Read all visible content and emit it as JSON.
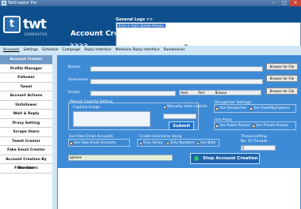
{
  "titlebar": {
    "title": "TwtCreator Pro"
  },
  "logo": {
    "word": "twt",
    "letter": "t",
    "sub": "DOMINATOR"
  },
  "page": {
    "title": "Account Creation",
    "arrows": ">>>>"
  },
  "logs": {
    "label": "General Logs >>",
    "line": "Error in Auto Update Module"
  },
  "menu": [
    "Accounts",
    "Settings",
    "Schedule",
    "Campaign",
    "Reply Interface",
    "Mentions Reply Interface",
    "Randomiser"
  ],
  "sidebar": [
    "Account Creator",
    "Profile Manager",
    "Follower",
    "Tweet",
    "Account Actions",
    "Unfollower",
    "Wait & Reply",
    "Proxy Setting",
    "Scrape Users",
    "Tweet Creator",
    "Fake Email Creator",
    "Account Creation By Browser",
    "Filter Users"
  ],
  "form": {
    "names_label": "Names",
    "usernames_label": "Usernames",
    "emails_label": "Emails",
    "browse": "Browse for File",
    "email_row_values": [
      "Host",
      "Port",
      "Browse"
    ],
    "captcha": {
      "title": "Manual Captcha Setting",
      "image_label": "Captcha Image",
      "manual": "Manually enter captcha",
      "submit": "Submit"
    },
    "decaptcher": {
      "title": "Decaptcher Settings",
      "use_decaptcher": "Use Decaptcher",
      "use_dbc": "Use DeathByCaptcha"
    },
    "proxy": {
      "title": "Use Proxy",
      "public": "Use Public Proxies",
      "private": "Use Private Proxies"
    },
    "fake_email": {
      "title": "Use Fake Email Accounts",
      "option": "Use Fake Email Accounts"
    },
    "username": {
      "title": "Create Username Using",
      "string": "Only String",
      "numbers": "Only Numbers",
      "both": "Use Both"
    },
    "thread": {
      "title": "Thread setting",
      "label": "No. Of Threads",
      "value": "5"
    },
    "input_value": "aphone",
    "stop": "Stop Account Creation"
  }
}
